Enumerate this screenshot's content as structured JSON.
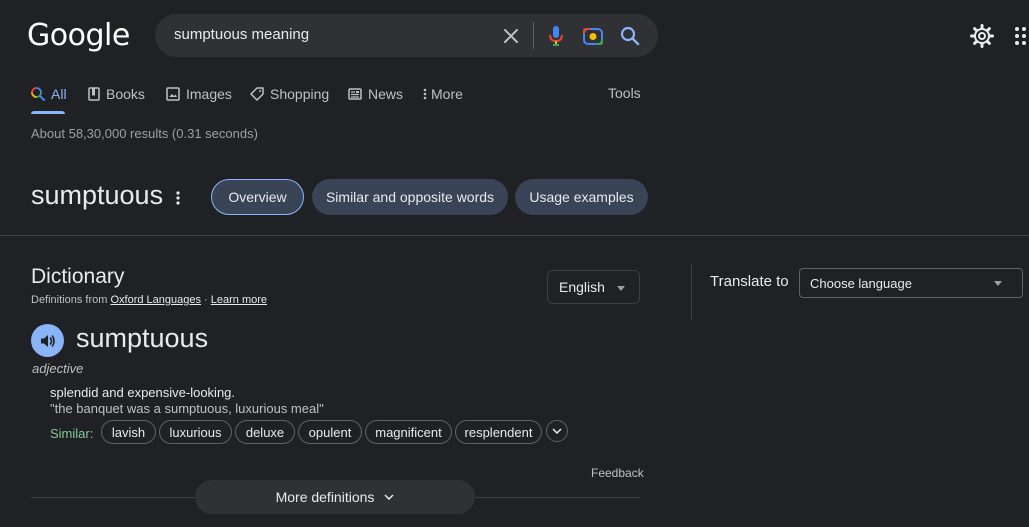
{
  "header": {
    "logo": "Google",
    "search_query": "sumptuous meaning",
    "icons": [
      "clear-icon",
      "mic-icon",
      "lens-icon",
      "search-icon",
      "settings-gear-icon",
      "apps-grid-icon"
    ]
  },
  "tabs": [
    {
      "label": "All",
      "icon": "search-multicolor-icon",
      "active": true
    },
    {
      "label": "Books",
      "icon": "book-icon",
      "active": false
    },
    {
      "label": "Images",
      "icon": "image-icon",
      "active": false
    },
    {
      "label": "Shopping",
      "icon": "tag-icon",
      "active": false
    },
    {
      "label": "News",
      "icon": "newspaper-icon",
      "active": false
    },
    {
      "label": "More",
      "icon": "vertical-dots-icon",
      "active": false
    }
  ],
  "tools_label": "Tools",
  "results_stats": "About 58,30,000 results (0.31 seconds)",
  "word_header": {
    "word": "sumptuous",
    "chips": [
      "Overview",
      "Similar and opposite words",
      "Usage examples"
    ]
  },
  "dictionary": {
    "title": "Dictionary",
    "source_prefix": "Definitions from ",
    "source_link": "Oxford Languages",
    "source_sep": " · ",
    "learn_more": "Learn more",
    "language": "English",
    "translate_label": "Translate to",
    "translate_placeholder": "Choose language",
    "headword": "sumptuous",
    "part_of_speech": "adjective",
    "definition": "splendid and expensive-looking.",
    "example": "\"the banquet was a sumptuous, luxurious meal\"",
    "similar_label": "Similar:",
    "synonyms": [
      "lavish",
      "luxurious",
      "deluxe",
      "opulent",
      "magnificent",
      "resplendent"
    ],
    "feedback": "Feedback",
    "more_definitions": "More definitions"
  },
  "colors": {
    "background": "#202124",
    "accent_blue": "#8ab4f8",
    "chip_bg": "#394457",
    "similar_green": "#81c995"
  }
}
